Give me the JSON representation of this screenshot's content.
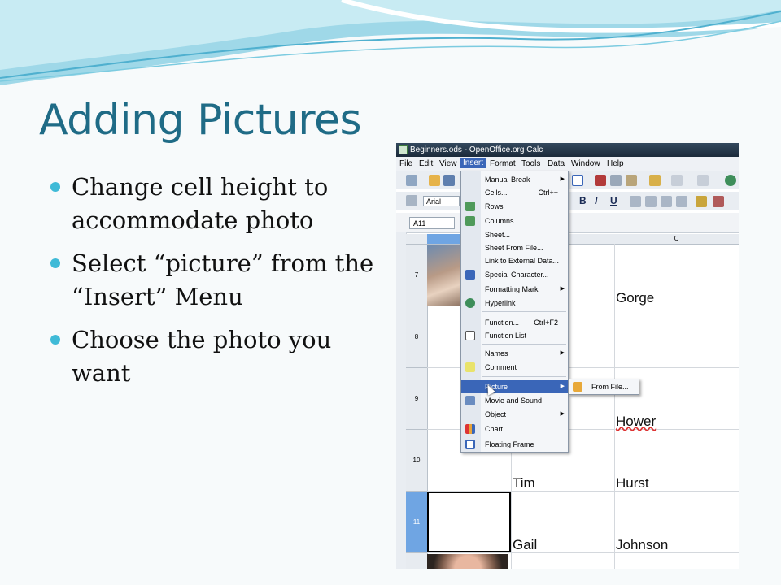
{
  "slide": {
    "title": "Adding Pictures",
    "bullets": [
      "Change cell height to accommodate photo",
      "Select “picture” from the “Insert” Menu",
      "Choose the photo you want"
    ],
    "colors": {
      "title": "#1f6b86",
      "bullet": "#3fbad7"
    }
  },
  "app": {
    "window_title": "Beginners.ods - OpenOffice.org Calc",
    "menu": [
      "File",
      "Edit",
      "View",
      "Insert",
      "Format",
      "Tools",
      "Data",
      "Window",
      "Help"
    ],
    "active_menu": "Insert",
    "font_name": "Arial",
    "format_buttons": [
      "B",
      "I",
      "U"
    ],
    "name_box": "A11",
    "column_headers": [
      "C"
    ],
    "row_headers": [
      "7",
      "8",
      "9",
      "10",
      "11"
    ],
    "selected_row": "11",
    "cells": {
      "r7_c": "Gorge",
      "r9_c": "Hower",
      "r10_b": "Tim",
      "r10_c": "Hurst",
      "r11_b": "Gail",
      "r11_c": "Johnson"
    },
    "insert_menu": [
      {
        "label": "Manual Break",
        "shortcut": "",
        "submenu": true,
        "icon": ""
      },
      {
        "label": "Cells...",
        "shortcut": "Ctrl++",
        "submenu": false,
        "icon": ""
      },
      {
        "label": "Rows",
        "shortcut": "",
        "submenu": false,
        "icon": "rows-icon"
      },
      {
        "label": "Columns",
        "shortcut": "",
        "submenu": false,
        "icon": "columns-icon"
      },
      {
        "label": "Sheet...",
        "shortcut": "",
        "submenu": false,
        "icon": ""
      },
      {
        "label": "Sheet From File...",
        "shortcut": "",
        "submenu": false,
        "icon": ""
      },
      {
        "label": "Link to External Data...",
        "shortcut": "",
        "submenu": false,
        "icon": ""
      },
      {
        "label": "Special Character...",
        "shortcut": "",
        "submenu": false,
        "icon": "special-character-icon"
      },
      {
        "label": "Formatting Mark",
        "shortcut": "",
        "submenu": true,
        "icon": ""
      },
      {
        "label": "Hyperlink",
        "shortcut": "",
        "submenu": false,
        "icon": "hyperlink-icon"
      },
      {
        "label": "Function...",
        "shortcut": "Ctrl+F2",
        "submenu": false,
        "icon": ""
      },
      {
        "label": "Function List",
        "shortcut": "",
        "submenu": false,
        "icon": "function-list-icon"
      },
      {
        "label": "Names",
        "shortcut": "",
        "submenu": true,
        "icon": ""
      },
      {
        "label": "Comment",
        "shortcut": "",
        "submenu": false,
        "icon": "comment-icon"
      },
      {
        "label": "Picture",
        "shortcut": "",
        "submenu": true,
        "icon": "",
        "highlighted": true
      },
      {
        "label": "Movie and Sound",
        "shortcut": "",
        "submenu": false,
        "icon": "movie-icon"
      },
      {
        "label": "Object",
        "shortcut": "",
        "submenu": true,
        "icon": ""
      },
      {
        "label": "Chart...",
        "shortcut": "",
        "submenu": false,
        "icon": "chart-icon"
      },
      {
        "label": "Floating Frame",
        "shortcut": "",
        "submenu": false,
        "icon": "frame-icon"
      }
    ],
    "picture_submenu": {
      "label": "From File..."
    }
  }
}
